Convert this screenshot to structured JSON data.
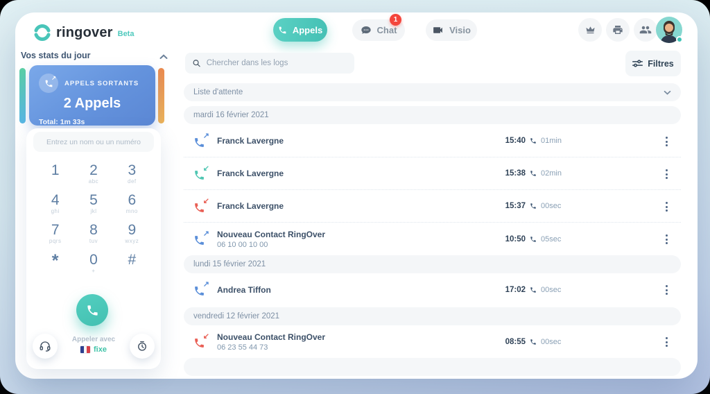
{
  "header": {
    "brand": "ringover",
    "beta": "Beta",
    "appels_label": "Appels",
    "chat_label": "Chat",
    "chat_badge": "1",
    "visio_label": "Visio"
  },
  "sidebar": {
    "stats_title": "Vos stats du jour",
    "stats_card": {
      "label": "APPELS SORTANTS",
      "count": "2 Appels",
      "total": "Total: 1m 33s"
    },
    "dialer": {
      "placeholder": "Entrez un nom ou un numéro",
      "keys": [
        {
          "d": "1",
          "s": ""
        },
        {
          "d": "2",
          "s": "abc"
        },
        {
          "d": "3",
          "s": "def"
        },
        {
          "d": "4",
          "s": "ghi"
        },
        {
          "d": "5",
          "s": "jkl"
        },
        {
          "d": "6",
          "s": "mno"
        },
        {
          "d": "7",
          "s": "pqrs"
        },
        {
          "d": "8",
          "s": "tuv"
        },
        {
          "d": "9",
          "s": "wxyz"
        },
        {
          "d": "*",
          "s": ""
        },
        {
          "d": "0",
          "s": "+"
        },
        {
          "d": "#",
          "s": ""
        }
      ],
      "call_with": "Appeler avec",
      "line_type": "fixe"
    }
  },
  "main": {
    "search_placeholder": "Chercher dans les logs",
    "filters_label": "Filtres",
    "queue_label": "Liste d'attente",
    "groups": [
      {
        "date": "mardi 16 février 2021",
        "calls": [
          {
            "type": "outgoing",
            "name": "Franck Lavergne",
            "number": "",
            "time": "15:40",
            "duration": "01min"
          },
          {
            "type": "incoming",
            "name": "Franck Lavergne",
            "number": "",
            "time": "15:38",
            "duration": "02min"
          },
          {
            "type": "missed",
            "name": "Franck Lavergne",
            "number": "",
            "time": "15:37",
            "duration": "00sec"
          },
          {
            "type": "outgoing",
            "name": "Nouveau Contact RingOver",
            "number": "06 10 00 10 00",
            "time": "10:50",
            "duration": "05sec"
          }
        ]
      },
      {
        "date": "lundi 15 février 2021",
        "calls": [
          {
            "type": "outgoing",
            "name": "Andrea Tiffon",
            "number": "",
            "time": "17:02",
            "duration": "00sec"
          }
        ]
      },
      {
        "date": "vendredi 12 février 2021",
        "calls": [
          {
            "type": "missed",
            "name": "Nouveau Contact RingOver",
            "number": "06 23 55 44 73",
            "time": "08:55",
            "duration": "00sec"
          }
        ]
      }
    ]
  },
  "icons": {
    "outgoing_arrow": "↗",
    "incoming_arrow": "↙",
    "missed_arrow": "↙"
  },
  "colors": {
    "accent_teal": "#48c5b8",
    "accent_blue": "#5b8fd9",
    "accent_red": "#e95f55",
    "badge_red": "#f4453c",
    "card_blue": "#6493dd"
  }
}
